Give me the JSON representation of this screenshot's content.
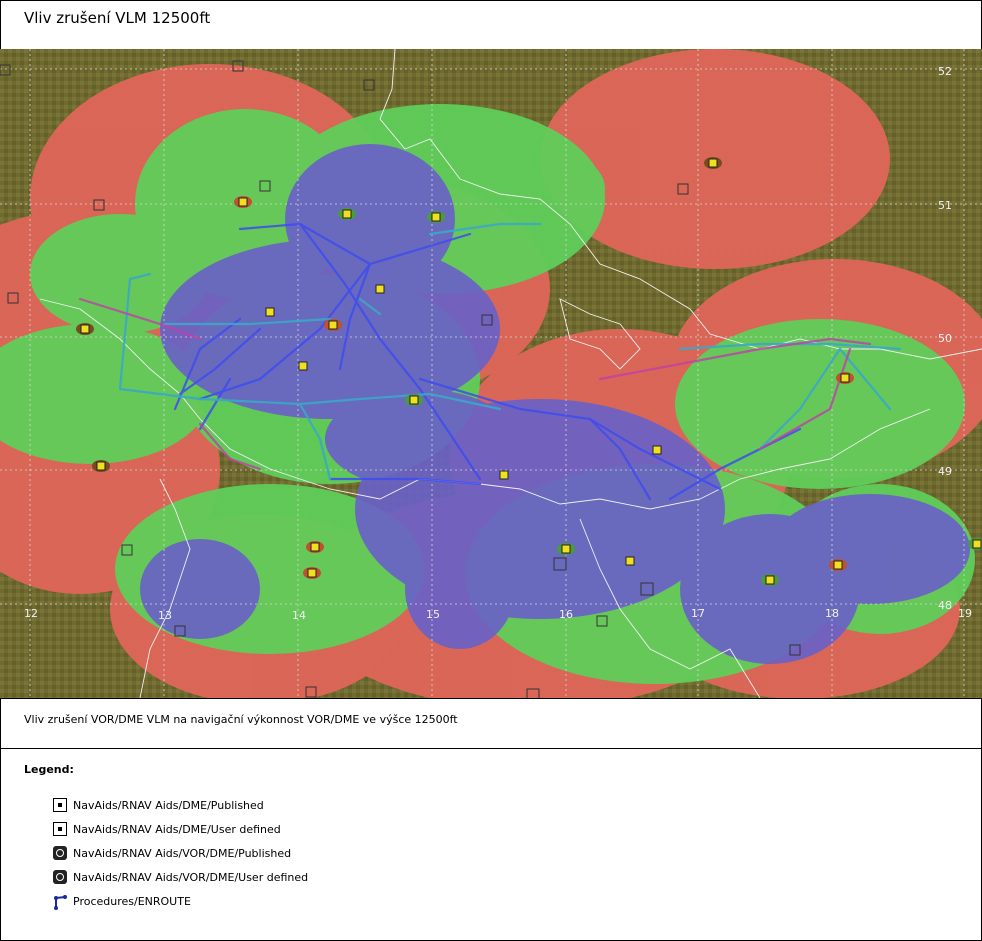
{
  "title": "Vliv zrušení VLM 12500ft",
  "caption": "Vliv zrušení VOR/DME VLM na navigační výkonnost VOR/DME ve výšce 12500ft",
  "map": {
    "lon_labels": [
      "12",
      "13",
      "14",
      "15",
      "16",
      "17",
      "18",
      "19"
    ],
    "lat_labels": [
      "52",
      "51",
      "50",
      "49",
      "48"
    ],
    "colors": {
      "terrain": "#6f6a2f",
      "red_coverage": "#e2665a",
      "green_coverage": "#5fce5a",
      "blue_coverage": "#6a62c6",
      "route_blue": "#3e4cf0",
      "route_cyan": "#3aa8c8",
      "route_magenta": "#c040a8"
    }
  },
  "legend": {
    "title": "Legend:",
    "items": [
      {
        "label": "NavAids/RNAV Aids/DME/Published",
        "icon": "dme-published-icon"
      },
      {
        "label": "NavAids/RNAV Aids/DME/User defined",
        "icon": "dme-user-icon"
      },
      {
        "label": "NavAids/RNAV Aids/VOR/DME/Published",
        "icon": "vordme-published-icon"
      },
      {
        "label": "NavAids/RNAV Aids/VOR/DME/User defined",
        "icon": "vordme-user-icon"
      },
      {
        "label": "Procedures/ENROUTE",
        "icon": "enroute-procedure-icon"
      }
    ]
  }
}
